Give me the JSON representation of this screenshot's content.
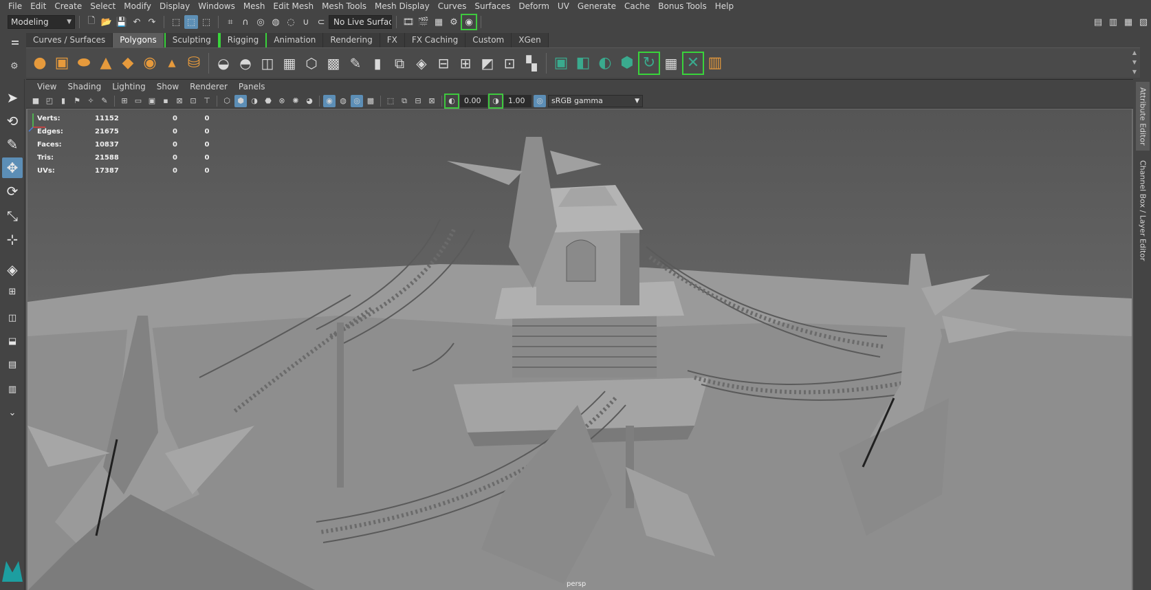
{
  "menubar": [
    "File",
    "Edit",
    "Create",
    "Select",
    "Modify",
    "Display",
    "Windows",
    "Mesh",
    "Edit Mesh",
    "Mesh Tools",
    "Mesh Display",
    "Curves",
    "Surfaces",
    "Deform",
    "UV",
    "Generate",
    "Cache",
    "Bonus Tools",
    "Help"
  ],
  "status": {
    "mode": "Modeling",
    "live_surface": "No Live Surface"
  },
  "shelf_tabs": [
    {
      "label": "Curves / Surfaces",
      "active": false,
      "bracket": false
    },
    {
      "label": "Polygons",
      "active": true,
      "bracket": false
    },
    {
      "label": "Sculpting",
      "active": false,
      "bracket": true
    },
    {
      "label": "Rigging",
      "active": false,
      "bracket": true
    },
    {
      "label": "Animation",
      "active": false,
      "bracket": false
    },
    {
      "label": "Rendering",
      "active": false,
      "bracket": false
    },
    {
      "label": "FX",
      "active": false,
      "bracket": false
    },
    {
      "label": "FX Caching",
      "active": false,
      "bracket": false
    },
    {
      "label": "Custom",
      "active": false,
      "bracket": false
    },
    {
      "label": "XGen",
      "active": false,
      "bracket": false
    }
  ],
  "panel_menu": [
    "View",
    "Shading",
    "Lighting",
    "Show",
    "Renderer",
    "Panels"
  ],
  "panel_toolbar": {
    "exposure": "0.00",
    "gamma": "1.00",
    "color_space": "sRGB gamma"
  },
  "hud": [
    {
      "label": "Verts:",
      "v1": "11152",
      "v2": "0",
      "v3": "0"
    },
    {
      "label": "Edges:",
      "v1": "21675",
      "v2": "0",
      "v3": "0"
    },
    {
      "label": "Faces:",
      "v1": "10837",
      "v2": "0",
      "v3": "0"
    },
    {
      "label": "Tris:",
      "v1": "21588",
      "v2": "0",
      "v3": "0"
    },
    {
      "label": "UVs:",
      "v1": "17387",
      "v2": "0",
      "v3": "0"
    }
  ],
  "camera": "persp",
  "right_tabs": {
    "attribute_editor": "Attribute Editor",
    "channel_box": "Channel Box / Layer Editor"
  },
  "colors": {
    "accent": "#5c8eb6",
    "highlight_green": "#3ec93e",
    "shelf_orange": "#e69a3c",
    "shelf_teal": "#3aaa8e"
  }
}
